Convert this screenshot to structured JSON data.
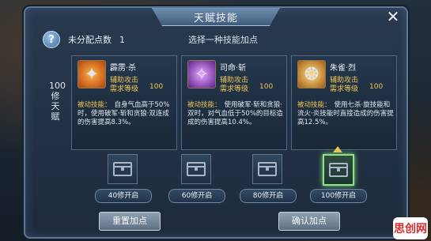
{
  "title": "天赋技能",
  "info": {
    "unassigned_label": "未分配点数",
    "unassigned_value": "1",
    "hint": "选择一种技能加点"
  },
  "side_label": "100修天赋",
  "cards": [
    {
      "icon": "fire-claw-icon",
      "name": "霹雳·杀",
      "type": "辅助攻击",
      "level_label": "需求等级",
      "level": "100",
      "passive": "被动技能：",
      "desc": "自身气血高于50%时，使用破军·斩和贪狼·双连成的伤害提高8.3%。"
    },
    {
      "icon": "purple-blade-icon",
      "name": "司命·斩",
      "type": "辅助攻击",
      "level_label": "需求等级",
      "level": "100",
      "passive": "被动技能：",
      "desc": "使用破军·斩和贪狼·双时，对气血低于50%的目标造成的伤害提高10.4%。"
    },
    {
      "icon": "golden-phoenix-icon",
      "name": "朱雀·烈",
      "type": "辅助攻击",
      "level_label": "需求等级",
      "level": "100",
      "passive": "被动技能：",
      "desc": "使用七杀·旋技能和流火·炎技能时直接造成的伤害提高12.5%。"
    }
  ],
  "unlocks": [
    {
      "label": "40修开启",
      "active": false
    },
    {
      "label": "60修开启",
      "active": false
    },
    {
      "label": "80修开启",
      "active": false
    },
    {
      "label": "100修开启",
      "active": true
    }
  ],
  "buttons": {
    "reset": "重置加点",
    "confirm": "确认加点"
  },
  "watermark": "思创网",
  "colors": {
    "accent_gold": "#f1c552",
    "active_green": "#93e08a"
  }
}
